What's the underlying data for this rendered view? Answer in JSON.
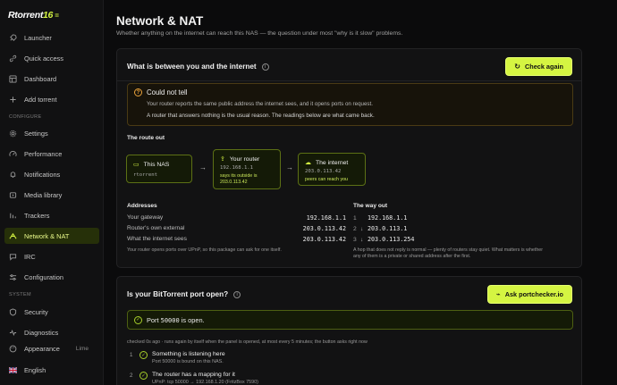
{
  "brand": {
    "name": "Rtorrent",
    "version": "16",
    "mark": "="
  },
  "sidebar": {
    "items": [
      {
        "label": "Launcher",
        "icon": "rocket-icon"
      },
      {
        "label": "Quick access",
        "icon": "link-icon"
      },
      {
        "label": "Dashboard",
        "icon": "dashboard-icon"
      },
      {
        "label": "Add torrent",
        "icon": "plus-icon"
      }
    ],
    "configure_label": "CONFIGURE",
    "configure_items": [
      {
        "label": "Settings",
        "icon": "gear-icon"
      },
      {
        "label": "Performance",
        "icon": "gauge-icon"
      },
      {
        "label": "Notifications",
        "icon": "bell-icon"
      },
      {
        "label": "Media library",
        "icon": "library-icon"
      },
      {
        "label": "Trackers",
        "icon": "trackers-icon"
      },
      {
        "label": "Network & NAT",
        "icon": "network-icon",
        "active": true
      },
      {
        "label": "IRC",
        "icon": "chat-icon"
      },
      {
        "label": "Configuration",
        "icon": "sliders-icon"
      }
    ],
    "system_label": "SYSTEM",
    "system_items": [
      {
        "label": "Security",
        "icon": "shield-icon"
      },
      {
        "label": "Diagnostics",
        "icon": "pulse-icon"
      },
      {
        "label": "Appearance",
        "icon": "palette-icon",
        "value": "Lime"
      }
    ],
    "language": {
      "label": "English",
      "icon": "flag-uk-icon"
    }
  },
  "page": {
    "title": "Network & NAT",
    "subtitle": "Whether anything on the internet can reach this NAS — the question under most \"why is it slow\" problems."
  },
  "between": {
    "title": "What is between you and the internet",
    "check_again": "Check again",
    "warning": {
      "title": "Could not tell",
      "line1": "Your router reports the same public address the internet sees, and it opens ports on request.",
      "line2": "A router that answers nothing is the usual reason. The readings below are what came back."
    },
    "route_label": "The route out",
    "route": {
      "nas": {
        "title": "This NAS",
        "sub": "rtorrent"
      },
      "router": {
        "title": "Your router",
        "ip": "192.168.1.1",
        "note1": "says its outside is",
        "note2": "203.0.113.42"
      },
      "internet": {
        "title": "The internet",
        "ip": "203.0.113.42",
        "note": "peers can reach you"
      }
    },
    "addresses_label": "Addresses",
    "addresses": [
      {
        "label": "Your gateway",
        "value": "192.168.1.1"
      },
      {
        "label": "Router's own external",
        "value": "203.0.113.42"
      },
      {
        "label": "What the internet sees",
        "value": "203.0.113.42"
      }
    ],
    "addresses_note": "Your router opens ports over UPnP, so this package can ask for one itself.",
    "way_out_label": "The way out",
    "hops": [
      {
        "n": "1",
        "ip": "192.168.1.1",
        "arrow": ""
      },
      {
        "n": "2",
        "ip": "203.0.113.1",
        "arrow": "↓"
      },
      {
        "n": "3",
        "ip": "203.0.113.254",
        "arrow": "↓"
      }
    ],
    "hops_note1": "A hop that does not reply is normal — plenty of routers stay quiet. What matters is whether",
    "hops_note2": "any of them is a private or shared address after the first."
  },
  "port": {
    "title": "Is your BitTorrent port open?",
    "ask_button": "Ask portchecker.io",
    "status_prefix": "Port",
    "status_port": "50000",
    "status_suffix": "is open.",
    "checked": "checked 0s ago · runs again by itself when the panel is opened, at most every 5 minutes; the button asks right now",
    "steps": [
      {
        "n": "1",
        "title": "Something is listening here",
        "desc": "Port 50000 is bound on this NAS."
      },
      {
        "n": "2",
        "title": "The router has a mapping for it",
        "desc": "UPnP: tcp 50000 → 192.168.1.20 (FritzBox 7590)"
      }
    ]
  }
}
